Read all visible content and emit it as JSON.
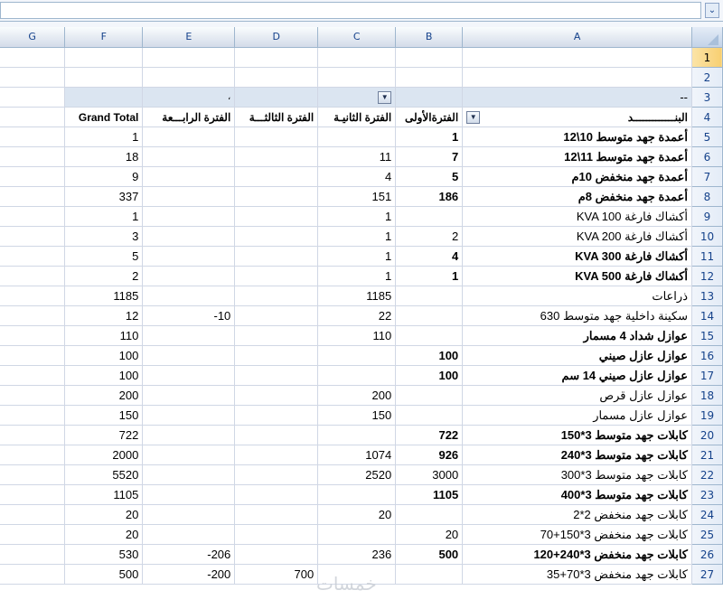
{
  "formula_bar": {
    "value": "",
    "expand_glyph": "⌄"
  },
  "columns": [
    "G",
    "F",
    "E",
    "D",
    "C",
    "B",
    "A"
  ],
  "pivot": {
    "dash": "--",
    "header_mark": "،",
    "dropdown_glyph": "▼",
    "headers": {
      "grand_total": "Grand Total",
      "period4": "الفترة الرابـــعة",
      "period3": "الفترة الثالثـــة",
      "period2": "الفترة الثانيـة",
      "period1": "الفترةالأولى",
      "item": "البنـــــــــــــد"
    },
    "rows": [
      {
        "n": "5",
        "item": "أعمدة جهد متوسط 10\\12",
        "p1": "1",
        "p2": "",
        "p3": "",
        "p4": "",
        "total": "1",
        "bold": true
      },
      {
        "n": "6",
        "item": "أعمدة جهد متوسط 11\\12",
        "p1": "7",
        "p2": "11",
        "p3": "",
        "p4": "",
        "total": "18",
        "bold": true
      },
      {
        "n": "7",
        "item": "أعمدة جهد منخفض 10م",
        "p1": "5",
        "p2": "4",
        "p3": "",
        "p4": "",
        "total": "9",
        "bold": true
      },
      {
        "n": "8",
        "item": "أعمدة جهد منخفض 8م",
        "p1": "186",
        "p2": "151",
        "p3": "",
        "p4": "",
        "total": "337",
        "bold": true
      },
      {
        "n": "9",
        "item": "أكشاك فارغة KVA 100",
        "p1": "",
        "p2": "1",
        "p3": "",
        "p4": "",
        "total": "1",
        "bold": false
      },
      {
        "n": "10",
        "item": "أكشاك فارغة KVA 200",
        "p1": "2",
        "p2": "1",
        "p3": "",
        "p4": "",
        "total": "3",
        "bold": false
      },
      {
        "n": "11",
        "item": "أكشاك فارغة KVA 300",
        "p1": "4",
        "p2": "1",
        "p3": "",
        "p4": "",
        "total": "5",
        "bold": true
      },
      {
        "n": "12",
        "item": "أكشاك فارغة KVA 500",
        "p1": "1",
        "p2": "1",
        "p3": "",
        "p4": "",
        "total": "2",
        "bold": true
      },
      {
        "n": "13",
        "item": "ذراعات",
        "p1": "",
        "p2": "1185",
        "p3": "",
        "p4": "",
        "total": "1185",
        "bold": false
      },
      {
        "n": "14",
        "item": "سكينة داخلية جهد متوسط 630",
        "p1": "",
        "p2": "22",
        "p3": "",
        "p4": "-10",
        "total": "12",
        "bold": false
      },
      {
        "n": "15",
        "item": "عوازل شداد 4 مسمار",
        "p1": "",
        "p2": "110",
        "p3": "",
        "p4": "",
        "total": "110",
        "bold": true
      },
      {
        "n": "16",
        "item": "عوازل عازل صيني",
        "p1": "100",
        "p2": "",
        "p3": "",
        "p4": "",
        "total": "100",
        "bold": true
      },
      {
        "n": "17",
        "item": "عوازل عازل صيني 14 سم",
        "p1": "100",
        "p2": "",
        "p3": "",
        "p4": "",
        "total": "100",
        "bold": true
      },
      {
        "n": "18",
        "item": "عوازل عازل قرص",
        "p1": "",
        "p2": "200",
        "p3": "",
        "p4": "",
        "total": "200",
        "bold": false
      },
      {
        "n": "19",
        "item": "عوازل عازل مسمار",
        "p1": "",
        "p2": "150",
        "p3": "",
        "p4": "",
        "total": "150",
        "bold": false
      },
      {
        "n": "20",
        "item": "كابلات جهد متوسط 3*150",
        "p1": "722",
        "p2": "",
        "p3": "",
        "p4": "",
        "total": "722",
        "bold": true
      },
      {
        "n": "21",
        "item": "كابلات جهد متوسط 3*240",
        "p1": "926",
        "p2": "1074",
        "p3": "",
        "p4": "",
        "total": "2000",
        "bold": true
      },
      {
        "n": "22",
        "item": "كابلات جهد متوسط 3*300",
        "p1": "3000",
        "p2": "2520",
        "p3": "",
        "p4": "",
        "total": "5520",
        "bold": false
      },
      {
        "n": "23",
        "item": "كابلات جهد متوسط 3*400",
        "p1": "1105",
        "p2": "",
        "p3": "",
        "p4": "",
        "total": "1105",
        "bold": true
      },
      {
        "n": "24",
        "item": "كابلات جهد منخفض 2*2",
        "p1": "",
        "p2": "20",
        "p3": "",
        "p4": "",
        "total": "20",
        "bold": false
      },
      {
        "n": "25",
        "item": "كابلات جهد منخفض 3*150+70",
        "p1": "20",
        "p2": "",
        "p3": "",
        "p4": "",
        "total": "20",
        "bold": false
      },
      {
        "n": "26",
        "item": "كابلات جهد منخفض 3*240+120",
        "p1": "500",
        "p2": "236",
        "p3": "",
        "p4": "-206",
        "total": "530",
        "bold": true
      },
      {
        "n": "27",
        "item": "كابلات جهد منخفض 3*70+35",
        "p1": "",
        "p2": "",
        "p3": "700",
        "p4": "-200",
        "total": "500",
        "bold": false
      }
    ]
  },
  "watermark": "خمسات"
}
